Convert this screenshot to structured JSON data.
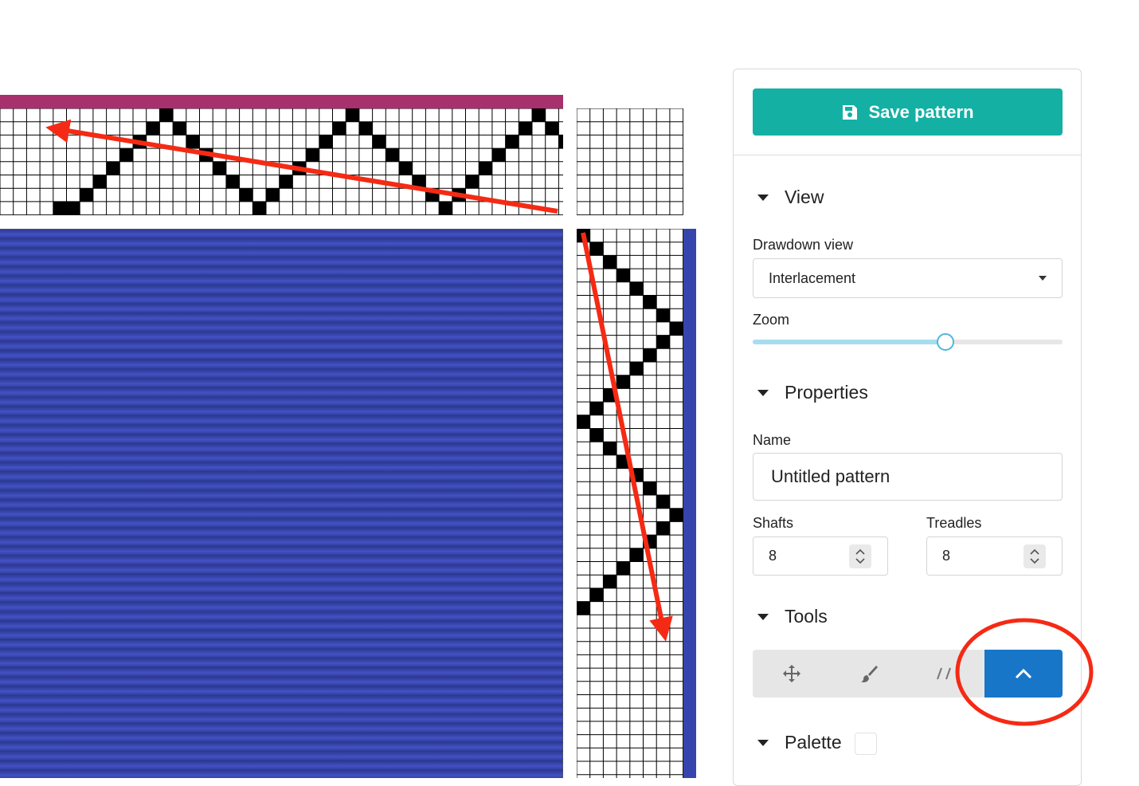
{
  "save": {
    "label": "Save pattern",
    "icon": "floppy-disk-icon"
  },
  "view": {
    "heading": "View",
    "drawdown_label": "Drawdown view",
    "drawdown_value": "Interlacement",
    "zoom_label": "Zoom",
    "zoom_level": 0.62
  },
  "properties": {
    "heading": "Properties",
    "name_label": "Name",
    "name_value": "Untitled pattern",
    "shafts_label": "Shafts",
    "shafts_value": "8",
    "treadles_label": "Treadles",
    "treadles_value": "8"
  },
  "tools": {
    "heading": "Tools",
    "items": [
      "move-icon",
      "brush-icon",
      "straight-draw-icon",
      "chevron-up-icon"
    ],
    "active": "chevron-up-icon"
  },
  "palette": {
    "heading": "Palette"
  },
  "colors": {
    "accent": "#14b0a4",
    "warp": "#a8306c",
    "weft": "#3645ad",
    "active_tool": "#1876c9",
    "annotation": "#f52a14"
  },
  "threading_pattern": [
    7,
    7,
    6,
    5,
    4,
    3,
    2,
    1,
    0,
    1,
    2,
    3,
    4,
    5,
    6,
    7,
    6,
    5,
    4,
    3,
    2,
    1,
    0,
    1,
    2,
    3,
    4,
    5,
    6,
    7,
    6,
    5,
    4,
    3,
    2,
    1,
    0,
    1,
    2,
    3,
    4,
    5,
    6
  ],
  "treadling_pattern": [
    0,
    1,
    2,
    3,
    4,
    5,
    6,
    7,
    6,
    5,
    4,
    3,
    2,
    1,
    0,
    1,
    2,
    3,
    4,
    5,
    6,
    7,
    6,
    5,
    4,
    3,
    2,
    1,
    0
  ]
}
